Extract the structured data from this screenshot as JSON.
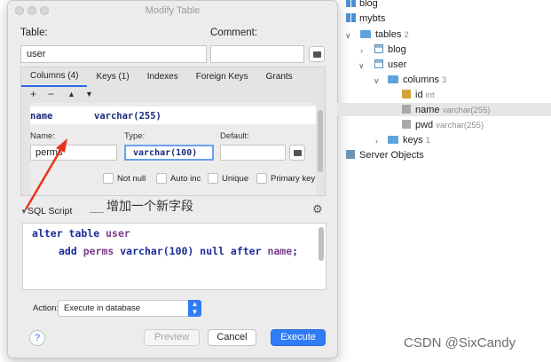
{
  "dialog": {
    "title": "Modify Table",
    "table_label": "Table:",
    "table_value": "user",
    "comment_label": "Comment:",
    "comment_value": "",
    "tabs": [
      "Columns (4)",
      "Keys (1)",
      "Indexes",
      "Foreign Keys",
      "Grants"
    ],
    "toolbar": {
      "add": "+",
      "remove": "−",
      "up": "▲",
      "down": "▼"
    },
    "column_row": {
      "name": "name",
      "type": "varchar(255)"
    },
    "field_labels": {
      "name": "Name:",
      "type": "Type:",
      "default": "Default:"
    },
    "field_values": {
      "name": "perms",
      "type": "varchar(100)",
      "default": ""
    },
    "checkboxes": [
      "Not null",
      "Auto inc",
      "Unique",
      "Primary key"
    ],
    "sql_script_label": "SQL Script",
    "sql_lines": {
      "line1_kw": "alter table",
      "line1_rest": " user",
      "line2_kw1": "add",
      "line2_col": " perms ",
      "line2_type": "varchar(",
      "line2_num": "100",
      "line2_close": ")",
      "line2_kw2": " null after ",
      "line2_ref": "name",
      "line2_end": ";"
    },
    "action_label": "Action:",
    "action_value": "Execute in database",
    "help": "?",
    "buttons": {
      "preview": "Preview",
      "cancel": "Cancel",
      "execute": "Execute"
    }
  },
  "annotation": {
    "text": "增加一个新字段",
    "arrow_color": "#e8331c"
  },
  "tree": {
    "items": [
      {
        "label": "blog",
        "sub": ""
      },
      {
        "label": "mybts",
        "sub": ""
      },
      {
        "label": "tables",
        "sub": "2"
      },
      {
        "label": "blog",
        "sub": ""
      },
      {
        "label": "user",
        "sub": ""
      },
      {
        "label": "columns",
        "sub": "3"
      },
      {
        "label": "id",
        "sub": "int"
      },
      {
        "label": "name",
        "sub": "varchar(255)"
      },
      {
        "label": "pwd",
        "sub": "varchar(255)"
      },
      {
        "label": "keys",
        "sub": "1"
      },
      {
        "label": "Server Objects",
        "sub": ""
      }
    ]
  },
  "watermark": "CSDN @SixCandy",
  "colors": {
    "accent": "#2f7cf6",
    "annotation": "#e8331c"
  }
}
